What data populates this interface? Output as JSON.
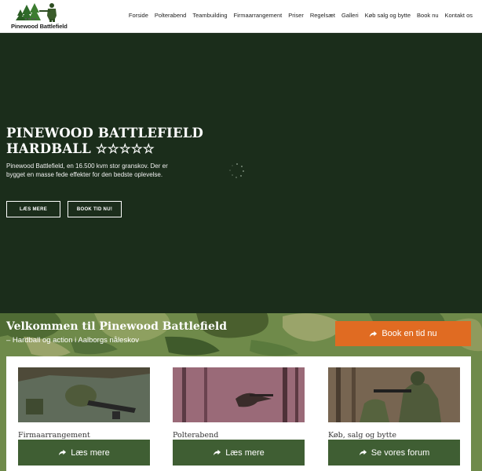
{
  "brand": {
    "name": "Pinewood Battlefield"
  },
  "nav": {
    "items": [
      {
        "label": "Forside"
      },
      {
        "label": "Polterabend"
      },
      {
        "label": "Teambuilding"
      },
      {
        "label": "Firmaarrangement"
      },
      {
        "label": "Priser"
      },
      {
        "label": "Regelsæt"
      },
      {
        "label": "Galleri"
      },
      {
        "label": "Køb salg og bytte"
      },
      {
        "label": "Book nu"
      },
      {
        "label": "Kontakt os"
      }
    ]
  },
  "hero": {
    "title_line1": "PINEWOOD BATTLEFIELD",
    "title_line2": "HARDBALL ☆☆☆☆☆",
    "description": "Pinewood Battlefield, en 16.500 kvm stor granskov. Der er bygget en masse fede effekter for den bedste oplevelse.",
    "read_more_label": "LÆS MERE",
    "book_label": "BOOK TID NU!"
  },
  "welcome": {
    "title": "Velkommen til Pinewood Battlefield",
    "subtitle": "– Hardball og action i Aalborgs nåleskov",
    "cta_label": "Book en tid nu",
    "cta_icon": "share-arrow-icon"
  },
  "cards": [
    {
      "title": "Firmaarrangement",
      "button_label": "Læs mere",
      "icon": "share-arrow-icon"
    },
    {
      "title": "Polterabend",
      "button_label": "Læs mere",
      "icon": "share-arrow-icon"
    },
    {
      "title": "Køb, salg og bytte",
      "button_label": "Se vores forum",
      "icon": "share-arrow-icon"
    }
  ],
  "colors": {
    "hero_bg": "#1b2d1b",
    "cta_orange": "#e06b22",
    "card_button_green": "#3f5e33",
    "camo_base": "#6f8a4a"
  }
}
